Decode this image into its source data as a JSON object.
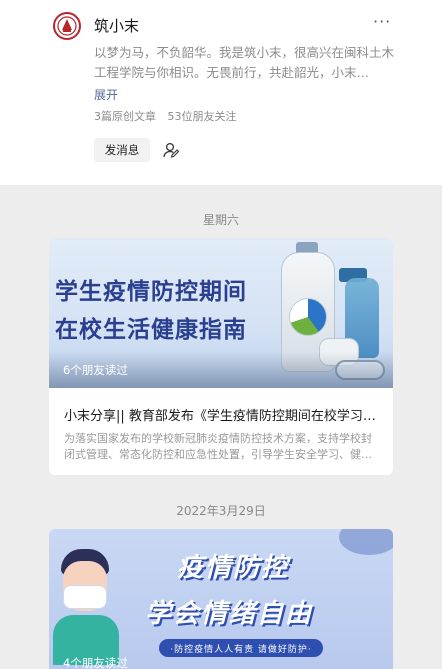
{
  "profile": {
    "name": "筑小末",
    "more_icon": "more-dots-icon",
    "bio": "以梦为马，不负韶华。我是筑小末，很高兴在闽科土木工程学院与你相识。无畏前行，共赴韶光，小末…",
    "expand_label": "展开",
    "original_count": "3篇原创文章",
    "friends_follow": "53位朋友关注",
    "send_message_label": "发消息",
    "follow_icon": "person-follow-icon"
  },
  "feed": [
    {
      "date": "星期六",
      "cover_line1": "学生疫情防控期间",
      "cover_line2": "在校生活健康指南",
      "read_count": "6个朋友读过",
      "title": "小末分享|| 教育部发布《学生疫情防控期间在校学习生活健康指南》",
      "desc": "为落实国家发布的学校新冠肺炎疫情防控技术方案，支持学校封闭式管理、常态化防控和应急性处置，引导学生安全学习、健…"
    },
    {
      "date": "2022年3月29日",
      "cover_line1": "疫情防控",
      "cover_line2": "学会情绪自由",
      "cover_pill": "·防控疫情人人有责 请做好防护·",
      "read_count": "4个朋友读过"
    }
  ],
  "colors": {
    "link": "#576b95",
    "cover_text": "#2a3f8f",
    "cover2_accent": "#2f4fb0"
  }
}
